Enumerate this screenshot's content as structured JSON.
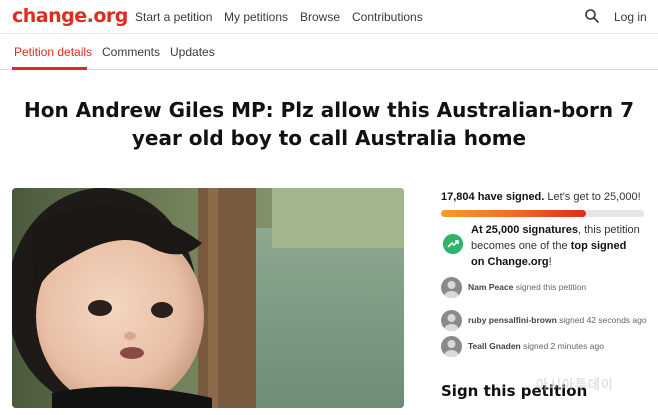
{
  "header": {
    "logo": "change.org",
    "nav": {
      "start": "Start a petition",
      "my": "My petitions",
      "browse": "Browse",
      "contrib": "Contributions"
    },
    "search_icon": "search-icon",
    "login": "Log in"
  },
  "tabs": {
    "details": "Petition details",
    "comments": "Comments",
    "updates": "Updates"
  },
  "petition": {
    "title": "Hon Andrew Giles MP: Plz allow this Australian-born 7 year old boy to call Australia home"
  },
  "sidebar": {
    "signed_count": "17,804 have signed.",
    "goal_text": "Let's get to 25,000!",
    "progress": 0.7122,
    "milestone": {
      "strong": "At 25,000 signatures",
      "middle": ", this petition becomes one of the ",
      "strong2": "top signed",
      "end_pre": "on Change.org",
      "end_post": "!"
    },
    "signers": [
      {
        "name": "Nam Peace",
        "action": "signed this petition"
      },
      {
        "name": "ruby pensalfini-brown",
        "action": "signed 42 seconds ago"
      },
      {
        "name": "Teall Gnaden",
        "action": "signed 2 minutes ago"
      }
    ],
    "sign_heading": "Sign this petition"
  },
  "watermark": "아시아투데이",
  "colors": {
    "brand": "#e02b20",
    "accent_green": "#2fb56b",
    "progress_start": "#f59d2a",
    "progress_end": "#e02b20"
  }
}
